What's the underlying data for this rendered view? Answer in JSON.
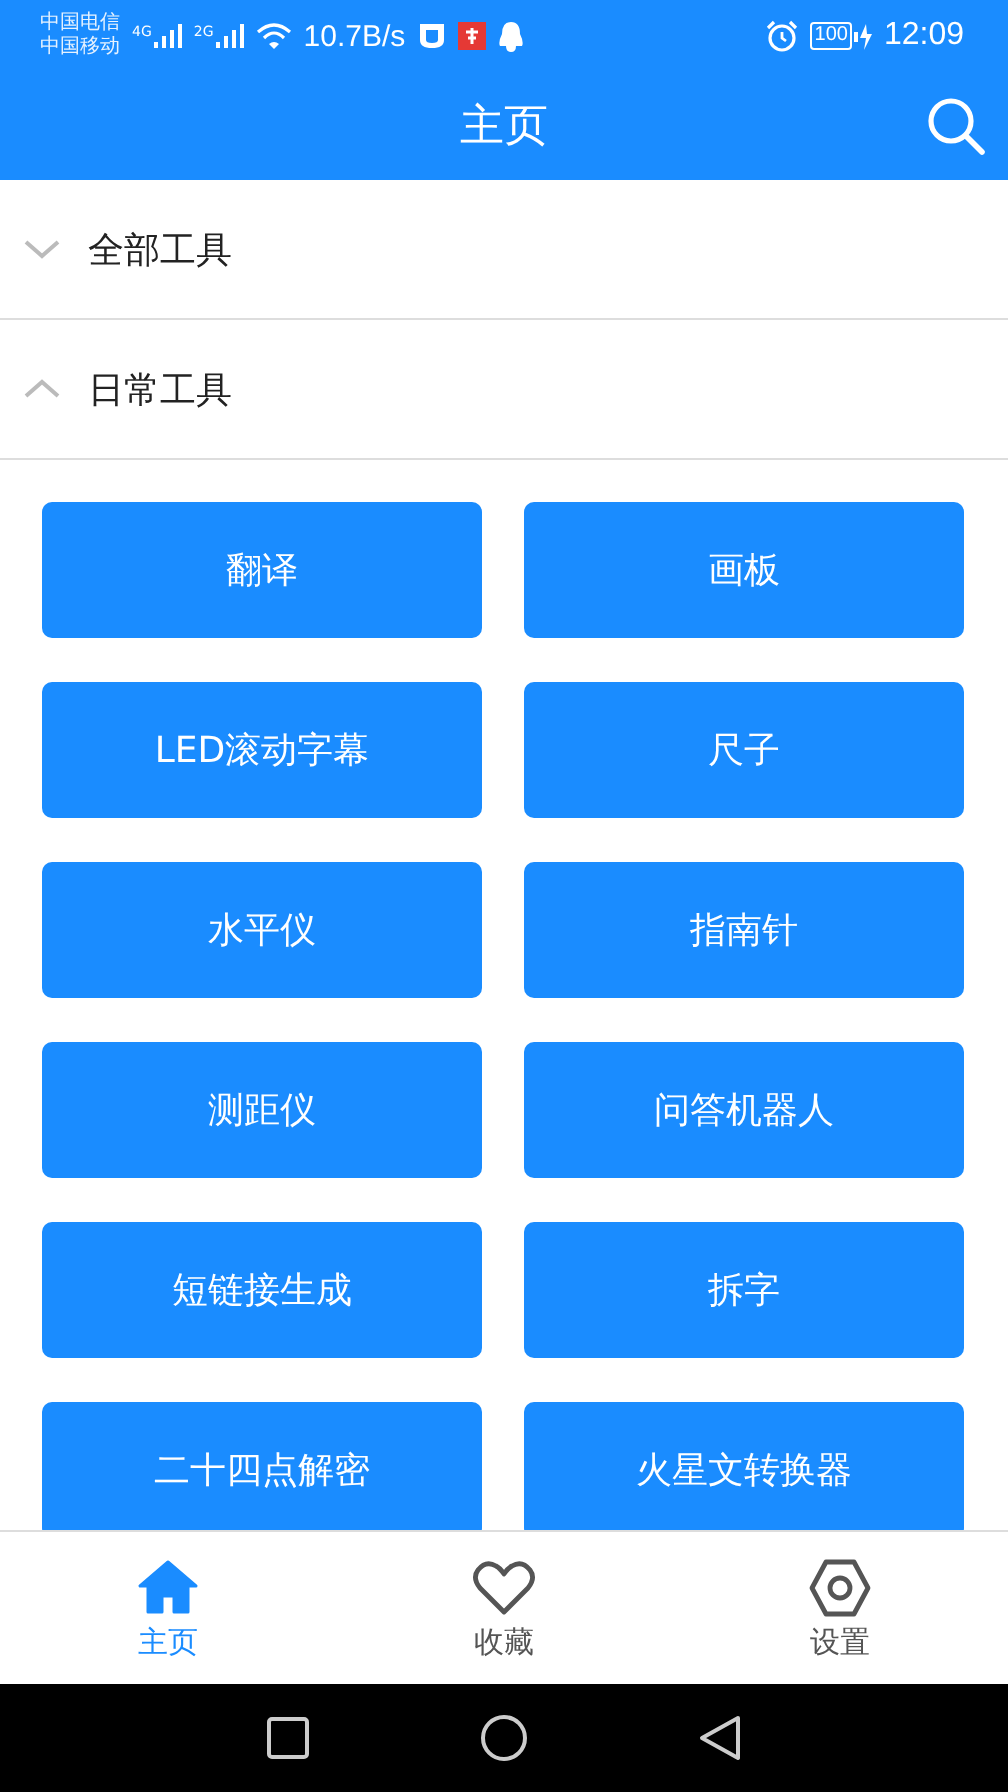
{
  "status_bar": {
    "carriers": [
      "中国电信",
      "中国移动"
    ],
    "networks": [
      "4G",
      "2G"
    ],
    "speed": "10.7B/s",
    "battery": "100",
    "time": "12:09"
  },
  "header": {
    "title": "主页"
  },
  "sections": [
    {
      "title": "全部工具",
      "expanded": false
    },
    {
      "title": "日常工具",
      "expanded": true,
      "tools": [
        "翻译",
        "画板",
        "LED滚动字幕",
        "尺子",
        "水平仪",
        "指南针",
        "测距仪",
        "问答机器人",
        "短链接生成",
        "拆字",
        "二十四点解密",
        "火星文转换器"
      ]
    }
  ],
  "tabs": [
    {
      "label": "主页",
      "kind": "home",
      "selected": true
    },
    {
      "label": "收藏",
      "kind": "favorites",
      "selected": false
    },
    {
      "label": "设置",
      "kind": "settings",
      "selected": false
    }
  ]
}
